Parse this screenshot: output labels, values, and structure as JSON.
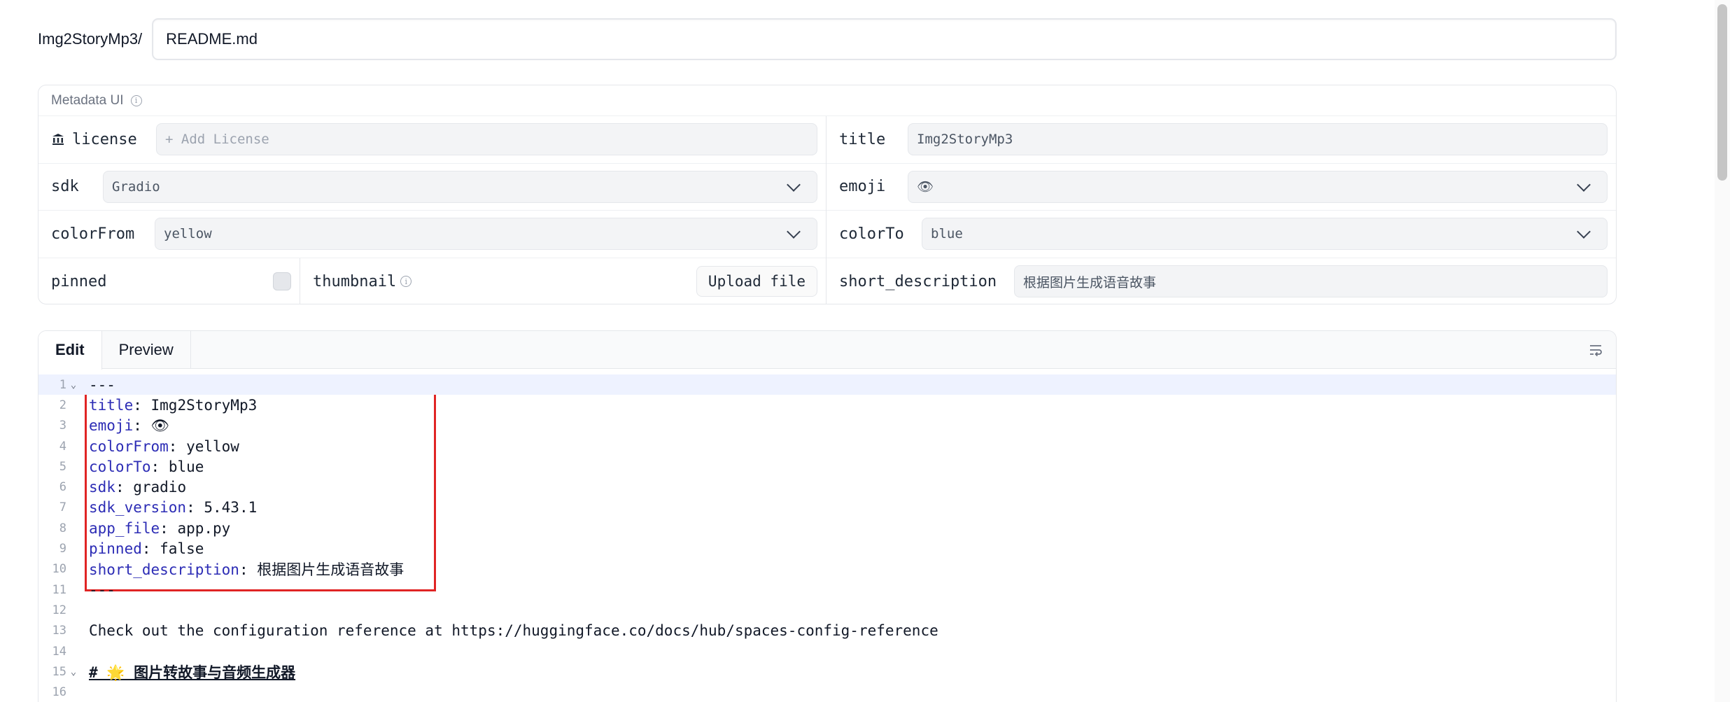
{
  "path": {
    "prefix": "Img2StoryMp3/",
    "filename": "README.md"
  },
  "metadata": {
    "header": "Metadata UI",
    "license_label": "license",
    "license_placeholder": "+ Add License",
    "title_label": "title",
    "title_value": "Img2StoryMp3",
    "sdk_label": "sdk",
    "sdk_value": "Gradio",
    "emoji_label": "emoji",
    "emoji_value": "👁",
    "colorFrom_label": "colorFrom",
    "colorFrom_value": "yellow",
    "colorTo_label": "colorTo",
    "colorTo_value": "blue",
    "pinned_label": "pinned",
    "pinned_checked": false,
    "thumbnail_label": "thumbnail",
    "upload_label": "Upload file",
    "short_description_label": "short_description",
    "short_description_value": "根据图片生成语音故事"
  },
  "editor": {
    "tabs": [
      "Edit",
      "Preview"
    ],
    "active_tab": "Edit",
    "lines": [
      {
        "n": "1",
        "key": "",
        "sep": "",
        "val": "---",
        "fold": true
      },
      {
        "n": "2",
        "key": "title",
        "sep": ": ",
        "val": "Img2StoryMp3"
      },
      {
        "n": "3",
        "key": "emoji",
        "sep": ": ",
        "val": "👁"
      },
      {
        "n": "4",
        "key": "colorFrom",
        "sep": ": ",
        "val": "yellow"
      },
      {
        "n": "5",
        "key": "colorTo",
        "sep": ": ",
        "val": "blue"
      },
      {
        "n": "6",
        "key": "sdk",
        "sep": ": ",
        "val": "gradio"
      },
      {
        "n": "7",
        "key": "sdk_version",
        "sep": ": ",
        "val": "5.43.1"
      },
      {
        "n": "8",
        "key": "app_file",
        "sep": ": ",
        "val": "app.py"
      },
      {
        "n": "9",
        "key": "pinned",
        "sep": ": ",
        "val": "false"
      },
      {
        "n": "10",
        "key": "short_description",
        "sep": ": ",
        "val": "根据图片生成语音故事"
      },
      {
        "n": "11",
        "key": "",
        "sep": "",
        "val": "---"
      },
      {
        "n": "12",
        "key": "",
        "sep": "",
        "val": ""
      },
      {
        "n": "13",
        "key": "",
        "sep": "",
        "val": "Check out the configuration reference at https://huggingface.co/docs/hub/spaces-config-reference"
      },
      {
        "n": "14",
        "key": "",
        "sep": "",
        "val": ""
      },
      {
        "n": "15",
        "key": "",
        "sep": "",
        "val": "# 🌟 图片转故事与音频生成器",
        "fold": true,
        "heading": true
      },
      {
        "n": "16",
        "key": "",
        "sep": "",
        "val": ""
      }
    ]
  },
  "colors": {
    "key": "#2c2cb5",
    "highlight_border": "#e02424",
    "current_line": "#eef2ff"
  }
}
